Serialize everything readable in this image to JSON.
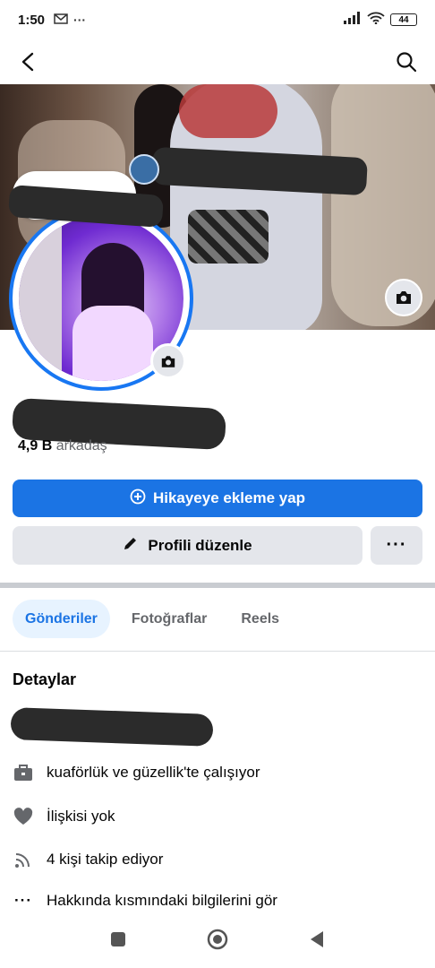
{
  "status_bar": {
    "time": "1:50",
    "left_icons": [
      "mail-icon",
      "more-dots-icon"
    ],
    "right_icons": [
      "signal-icon",
      "wifi-icon",
      "battery-icon"
    ],
    "battery": "44"
  },
  "app_bar": {
    "icons": [
      "back-arrow-icon",
      "search-icon"
    ]
  },
  "profile": {
    "friends_count": "4,9 B",
    "friends_label": "arkadaş"
  },
  "actions": {
    "add_story": "Hikayeye ekleme yap",
    "edit_profile": "Profili düzenle",
    "more": "···"
  },
  "tabs": [
    {
      "label": "Gönderiler",
      "active": true
    },
    {
      "label": "Fotoğraflar",
      "active": false
    },
    {
      "label": "Reels",
      "active": false
    }
  ],
  "details": {
    "title": "Detaylar",
    "items": [
      {
        "icon": "briefcase-icon",
        "text": "kuaförlük ve güzellik'te çalışıyor"
      },
      {
        "icon": "heart-icon",
        "text": "İlişkisi yok"
      },
      {
        "icon": "rss-icon",
        "text": "4 kişi takip ediyor"
      },
      {
        "icon": "more-dots-icon",
        "text": "Hakkında kısmındaki bilgilerini gör"
      }
    ]
  },
  "colors": {
    "accent": "#1b74e4",
    "secondary_button": "#e4e6eb",
    "active_tab_bg": "#e7f3ff"
  }
}
